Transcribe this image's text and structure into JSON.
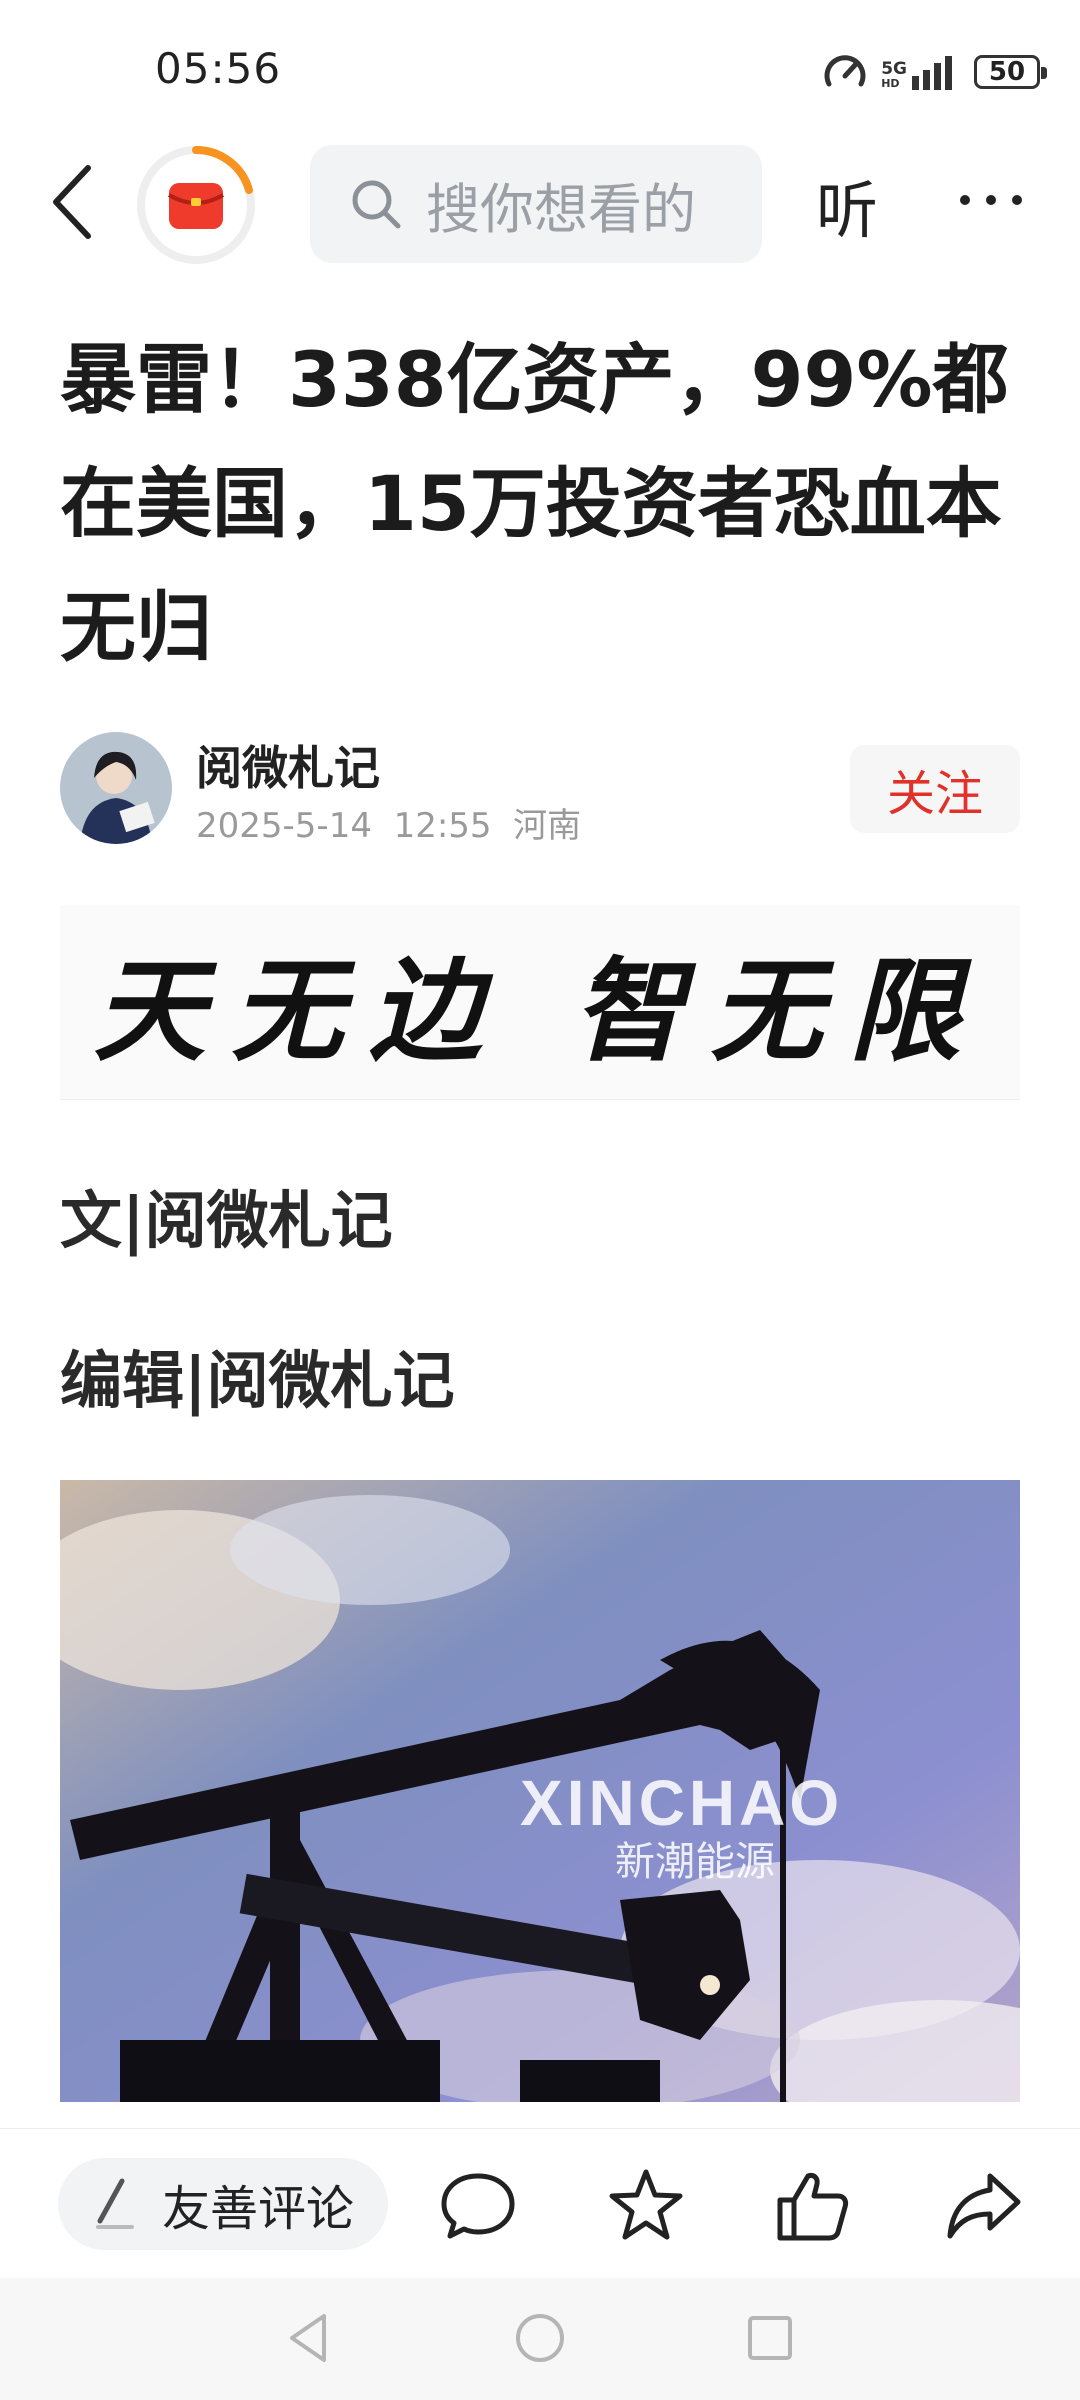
{
  "status_bar": {
    "time": "05:56",
    "network_top": "5G",
    "network_bottom": "HD",
    "battery": "50"
  },
  "top_nav": {
    "search_placeholder": "搜你想看的",
    "listen_label": "听"
  },
  "article": {
    "title": "暴雷！338亿资产，99%都在美国，15万投资者恐血本无归",
    "author": "阅微札记",
    "meta": "2025-5-14  12:55  河南",
    "follow_label": "关注",
    "banner_text": "天无边 智无限",
    "byline_text": "文|阅微札记",
    "editor_text": "编辑|阅微札记",
    "photo": {
      "watermark_en": "XINCHAO",
      "watermark_cn": "新潮能源"
    }
  },
  "bottom_bar": {
    "comment_label": "友善评论"
  },
  "colors": {
    "accent_red": "#e0312b",
    "redpacket_orange": "#f7931e",
    "search_bg": "#f1f3f5"
  },
  "icons": [
    "back-icon",
    "red-packet-icon",
    "search-icon",
    "more-icon",
    "pen-icon",
    "comment-icon",
    "star-icon",
    "like-icon",
    "share-icon"
  ]
}
